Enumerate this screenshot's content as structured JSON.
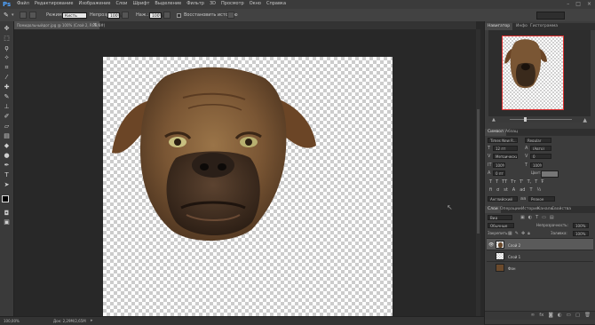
{
  "app": {
    "logo": "Ps"
  },
  "menu": [
    "Файл",
    "Редактирование",
    "Изображение",
    "Слои",
    "Шрифт",
    "Выделение",
    "Фильтр",
    "3D",
    "Просмотр",
    "Окно",
    "Справка"
  ],
  "options": {
    "mode_label": "Режим:",
    "mode_value": "Кисть",
    "opacity_label": "Непрозр.:",
    "opacity_value": "100%",
    "pressure_label": "Наж.:",
    "pressure_value": "100%",
    "history_label": "Восстановить историю"
  },
  "document": {
    "tab_title": "Помидольныйдог.jpg @ 100% (Слой 2, RGB/8#)",
    "tab_close": "×",
    "zoom": "100,00%",
    "doc_size": "Док: 2,29М/2,65М"
  },
  "panels": {
    "navigator_tabs": [
      "Навигатор",
      "Инфо",
      "Гистограмма"
    ],
    "char_tabs": [
      "Символ",
      "Абзац"
    ],
    "font_family": "Times New R...",
    "font_style": "Regular",
    "font_size": "12 пт",
    "leading": "(Авто)",
    "kerning": "Метрический",
    "tracking": "0",
    "vscale": "100%",
    "hscale": "100%",
    "baseline": "0 пт",
    "color_label": "Цвет:",
    "language": "Английский",
    "antialias": "Резкое",
    "layers_tabs": [
      "Слои",
      "Операции",
      "История",
      "Каналы",
      "Свойства"
    ],
    "layer_kind": "Вид",
    "blend": "Обычные",
    "opacity_label": "Непрозрачность:",
    "opacity_value": "100%",
    "lock_label": "Закрепить:",
    "fill_label": "Заливка:",
    "fill_value": "100%",
    "layers": [
      {
        "name": "Слой 2",
        "selected": true
      },
      {
        "name": "Слой 1",
        "selected": false
      },
      {
        "name": "Фон",
        "selected": false
      }
    ]
  },
  "colors": {
    "accent": "#4fa3ff",
    "background": "#282828",
    "panel": "#3c3c3c",
    "nav_frame": "#e03030"
  }
}
